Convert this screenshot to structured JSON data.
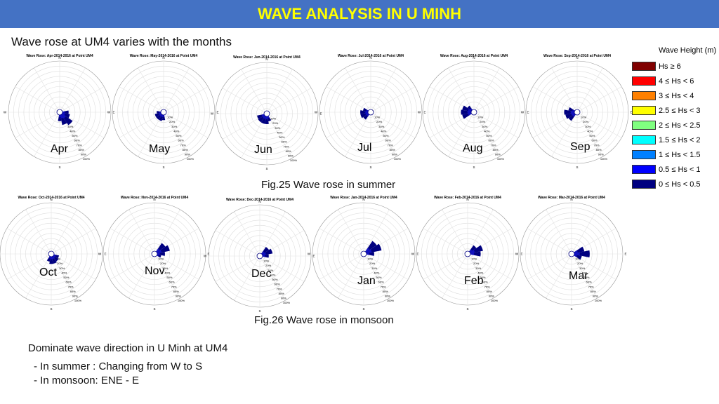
{
  "header": {
    "title": "WAVE ANALYSIS IN U MINH"
  },
  "subtitle": "Wave rose at UM4 varies with the months",
  "captions": {
    "summer": "Fig.25 Wave rose in summer",
    "monsoon": "Fig.26 Wave rose in monsoon"
  },
  "notes": {
    "heading": "Dominate wave direction in U Minh at UM4",
    "summer": "- In summer : Changing from  W  to  S",
    "monsoon": "- In monsoon: ENE - E"
  },
  "legend": {
    "title": "Wave Height (m)",
    "items": [
      {
        "label": "Hs ≥ 6",
        "color": "#800000"
      },
      {
        "label": "4 ≤ Hs < 6",
        "color": "#ff0000"
      },
      {
        "label": "3 ≤ Hs < 4",
        "color": "#ff8000"
      },
      {
        "label": "2.5 ≤ Hs < 3",
        "color": "#ffff00"
      },
      {
        "label": "2 ≤ Hs < 2.5",
        "color": "#80ff80"
      },
      {
        "label": "1.5 ≤ Hs < 2",
        "color": "#00ffff"
      },
      {
        "label": "1 ≤ Hs < 1.5",
        "color": "#0080ff"
      },
      {
        "label": "0.5 ≤ Hs < 1",
        "color": "#0000ff"
      },
      {
        "label": "0 ≤ Hs < 0.5",
        "color": "#000080"
      }
    ]
  },
  "chart_data": {
    "type": "wave-rose",
    "compass": [
      "N",
      "E",
      "S",
      "W"
    ],
    "radial_ticks": [
      "10%",
      "20%",
      "30%",
      "40%",
      "50%",
      "60%",
      "70%",
      "80%",
      "90%",
      "100%"
    ],
    "roses": [
      {
        "month": "Apr",
        "title": "Wave Rose: Apr-2014-2016 at Point UM4",
        "petals": [
          [
            90,
            12
          ],
          [
            112.5,
            15
          ],
          [
            135,
            25
          ],
          [
            157.5,
            20
          ],
          [
            180,
            12
          ]
        ]
      },
      {
        "month": "May",
        "title": "Wave Rose: May-2014-2016 at Point UM4",
        "petals": [
          [
            180,
            10
          ],
          [
            202.5,
            12
          ],
          [
            225,
            12
          ],
          [
            247.5,
            12
          ],
          [
            270,
            8
          ]
        ]
      },
      {
        "month": "Jun",
        "title": "Wave Rose: Jun-2014-2016 at Point UM4",
        "petals": [
          [
            157.5,
            10
          ],
          [
            180,
            15
          ],
          [
            202.5,
            15
          ],
          [
            225,
            15
          ],
          [
            247.5,
            14
          ]
        ]
      },
      {
        "month": "Jul",
        "title": "Wave Rose: Jul-2014-2016 at Point UM4",
        "petals": [
          [
            225,
            12
          ],
          [
            247.5,
            15
          ],
          [
            270,
            15
          ],
          [
            292.5,
            10
          ]
        ]
      },
      {
        "month": "Aug",
        "title": "Wave Rose: Aug-2014-2016 at Point UM4",
        "petals": [
          [
            247.5,
            18
          ],
          [
            270,
            20
          ],
          [
            292.5,
            18
          ],
          [
            315,
            10
          ]
        ]
      },
      {
        "month": "Sep",
        "title": "Wave Rose: Sep-2014-2016 at Point UM4",
        "petals": [
          [
            225,
            15
          ],
          [
            247.5,
            18
          ],
          [
            270,
            20
          ],
          [
            292.5,
            12
          ]
        ]
      },
      {
        "month": "Oct",
        "title": "Wave Rose: Oct-2014-2016 at Point UM4",
        "petals": [
          [
            112.5,
            10
          ],
          [
            135,
            12
          ],
          [
            157.5,
            14
          ],
          [
            180,
            14
          ],
          [
            202.5,
            10
          ]
        ]
      },
      {
        "month": "Nov",
        "title": "Wave Rose: Nov-2014-2016 at Point UM4",
        "petals": [
          [
            45,
            20
          ],
          [
            67.5,
            25
          ],
          [
            90,
            15
          ],
          [
            112.5,
            8
          ]
        ]
      },
      {
        "month": "Dec",
        "title": "Wave Rose: Dec-2014-2016 at Point UM4",
        "petals": [
          [
            45,
            16
          ],
          [
            67.5,
            20
          ],
          [
            90,
            12
          ]
        ]
      },
      {
        "month": "Jan",
        "title": "Wave Rose: Jan-2014-2016 at Point UM4",
        "petals": [
          [
            45,
            25
          ],
          [
            67.5,
            30
          ],
          [
            90,
            15
          ]
        ]
      },
      {
        "month": "Feb",
        "title": "Wave Rose: Feb-2014-2016 at Point UM4",
        "petals": [
          [
            45,
            15
          ],
          [
            67.5,
            25
          ],
          [
            90,
            20
          ]
        ]
      },
      {
        "month": "Mar",
        "title": "Wave Rose: Mar-2014-2016 at Point UM4",
        "petals": [
          [
            67.5,
            20
          ],
          [
            90,
            30
          ],
          [
            112.5,
            15
          ]
        ]
      }
    ]
  }
}
